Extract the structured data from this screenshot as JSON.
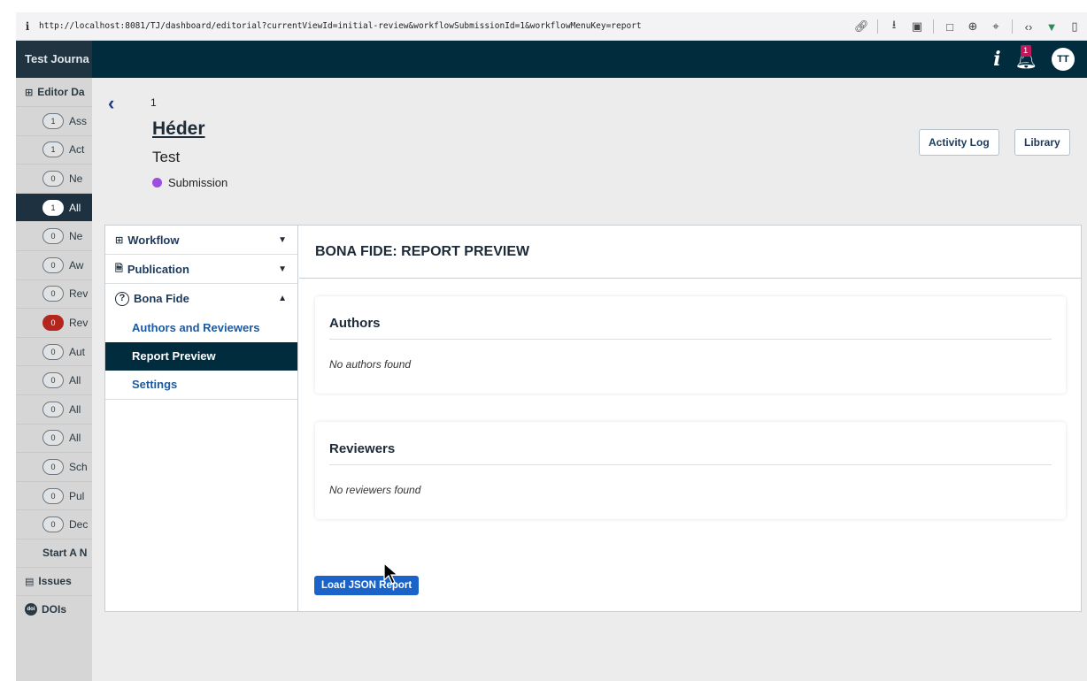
{
  "browser": {
    "url": "http://localhost:8081/TJ/dashboard/editorial?currentViewId=initial-review&workflowSubmissionId=1&workflowMenuKey=report",
    "info_glyph": "i"
  },
  "appbar": {
    "journal_name": "Test Journa",
    "help_glyph": "i",
    "notification_count": "1",
    "avatar_initials": "TT"
  },
  "sidebar": {
    "header": "Editor Da",
    "items": [
      {
        "count": "1",
        "label": "Ass"
      },
      {
        "count": "1",
        "label": "Act"
      },
      {
        "count": "0",
        "label": "Ne"
      },
      {
        "count": "1",
        "label": "All"
      },
      {
        "count": "0",
        "label": "Ne"
      },
      {
        "count": "0",
        "label": "Aw"
      },
      {
        "count": "0",
        "label": "Rev"
      },
      {
        "count": "0",
        "label": "Rev"
      },
      {
        "count": "0",
        "label": "Aut"
      },
      {
        "count": "0",
        "label": "All"
      },
      {
        "count": "0",
        "label": "All"
      },
      {
        "count": "0",
        "label": "All"
      },
      {
        "count": "0",
        "label": "Sch"
      },
      {
        "count": "0",
        "label": "Pul"
      },
      {
        "count": "0",
        "label": "Dec"
      }
    ],
    "start_new": "Start A N",
    "issues": "Issues",
    "dois": "DOIs",
    "doi_badge": "doi"
  },
  "submission": {
    "id": "1",
    "author": "Héder",
    "title": "Test",
    "stage": "Submission",
    "stage_color": "#9c4fde",
    "activity_log_label": "Activity Log",
    "library_label": "Library"
  },
  "workflow_nav": {
    "workflow_label": "Workflow",
    "publication_label": "Publication",
    "bona_fide_label": "Bona Fide",
    "sub_items": [
      "Authors and Reviewers",
      "Report Preview",
      "Settings"
    ]
  },
  "report": {
    "title": "BONA FIDE: REPORT PREVIEW",
    "authors_heading": "Authors",
    "authors_empty": "No authors found",
    "reviewers_heading": "Reviewers",
    "reviewers_empty": "No reviewers found",
    "load_button": "Load JSON Report"
  },
  "colors": {
    "primary": "#1a64c9",
    "header_bg": "#002c3e",
    "badge_red": "#b3261e"
  }
}
